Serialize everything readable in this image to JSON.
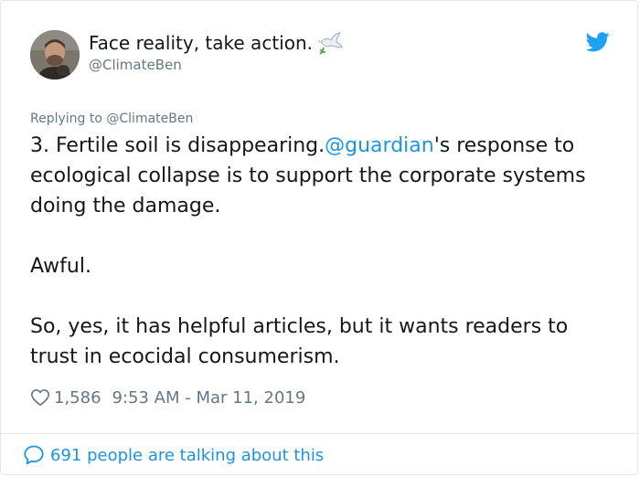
{
  "author": {
    "display_name": "Face reality, take action.",
    "handle": "@ClimateBen",
    "dove_icon": "dove-icon",
    "avatar_icon": "avatar"
  },
  "platform_icon": "twitter-bird-icon",
  "reply": {
    "prefix": "Replying to ",
    "target": "@ClimateBen"
  },
  "tweet": {
    "line1_before": "3. Fertile soil is disappearing.",
    "mention": "@guardian",
    "line1_after": "'s response to ecological collapse is to support the corporate systems doing the damage.",
    "paragraph2": "Awful.",
    "paragraph3": "So, yes, it has helpful articles, but it wants readers to trust in ecocidal consumerism."
  },
  "meta": {
    "like_count": "1,586",
    "timestamp": "9:53 AM - Mar 11, 2019"
  },
  "footer": {
    "talking_text": "691 people are talking about this"
  },
  "colors": {
    "accent": "#1b95e0",
    "secondary_text": "#657786",
    "primary_text": "#14171a",
    "border": "#e1e8ed"
  }
}
